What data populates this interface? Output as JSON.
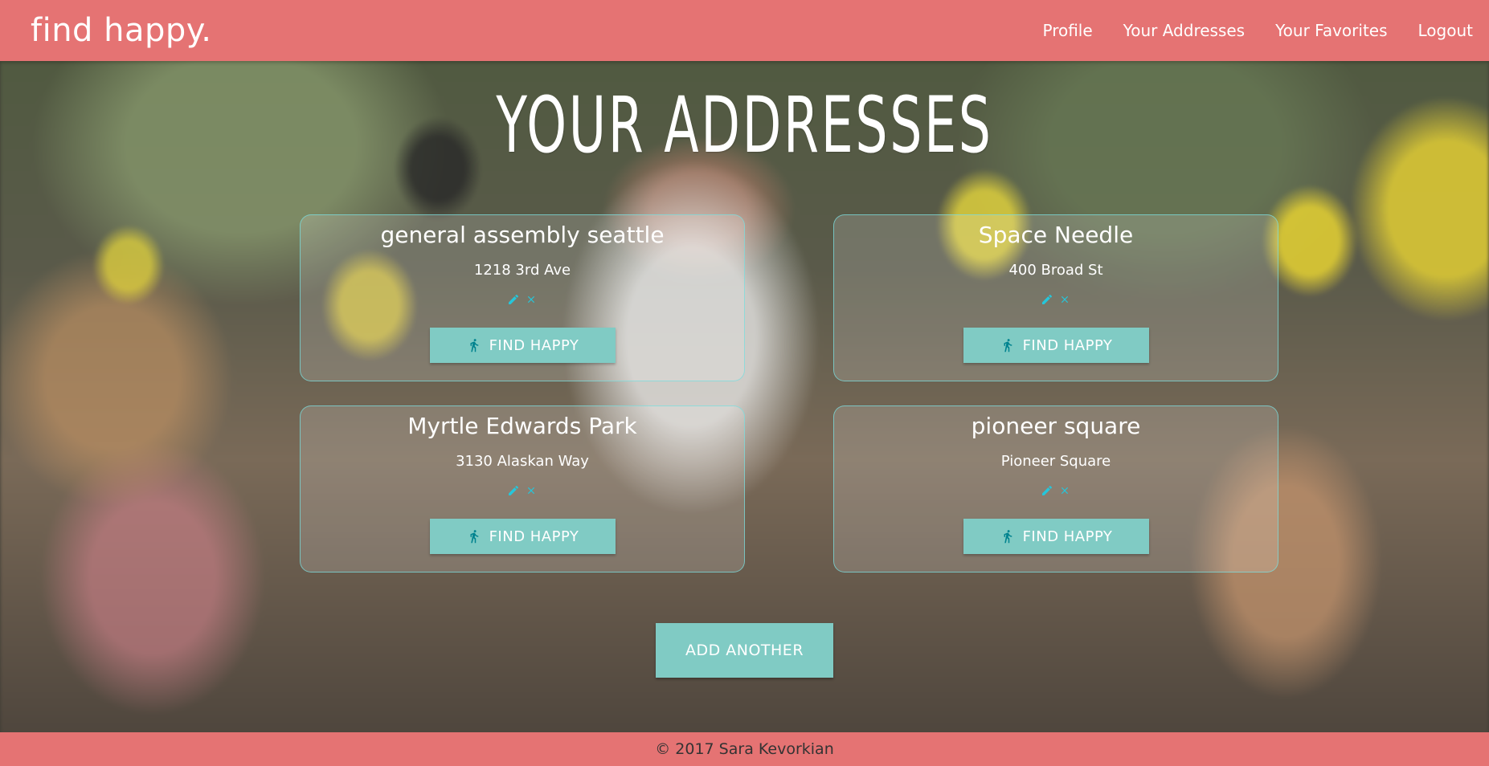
{
  "navbar": {
    "brand": "find happy.",
    "links": [
      "Profile",
      "Your Addresses",
      "Your Favorites",
      "Logout"
    ]
  },
  "page": {
    "title": "Your Addresses"
  },
  "addresses": [
    {
      "name": "general assembly seattle",
      "address": "1218 3rd Ave",
      "button_label": "FIND HAPPY"
    },
    {
      "name": "Space Needle",
      "address": "400 Broad St",
      "button_label": "FIND HAPPY"
    },
    {
      "name": "Myrtle Edwards Park",
      "address": "3130 Alaskan Way",
      "button_label": "FIND HAPPY"
    },
    {
      "name": "pioneer square",
      "address": "Pioneer Square",
      "button_label": "FIND HAPPY"
    }
  ],
  "icons": {
    "edit": "pencil-icon",
    "delete": "close-icon",
    "walk": "walking-person-icon"
  },
  "colors": {
    "navbar": "#e57373",
    "button": "#80cbc4",
    "action_icons": "#26c6da"
  },
  "add_button_label": "ADD ANOTHER",
  "footer": {
    "text": "© 2017 Sara Kevorkian"
  }
}
